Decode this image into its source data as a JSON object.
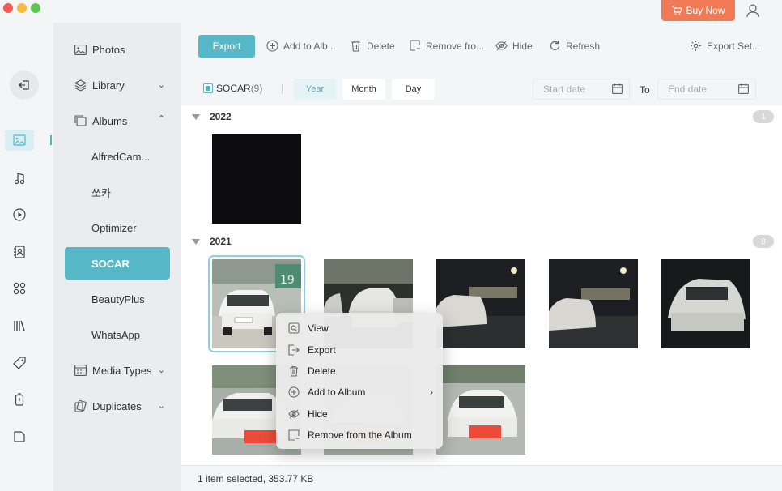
{
  "header": {
    "buy_now": "Buy Now"
  },
  "sidebar": {
    "items": [
      {
        "label": "Photos",
        "icon": "photos-icon"
      },
      {
        "label": "Library",
        "icon": "layers-icon"
      },
      {
        "label": "Albums",
        "icon": "albums-icon"
      },
      {
        "label": "AlfredCam..."
      },
      {
        "label": "쏘카"
      },
      {
        "label": "Optimizer"
      },
      {
        "label": "SOCAR"
      },
      {
        "label": "BeautyPlus"
      },
      {
        "label": "WhatsApp"
      },
      {
        "label": "Media Types",
        "icon": "media-types-icon"
      },
      {
        "label": "Duplicates",
        "icon": "duplicates-icon"
      }
    ]
  },
  "toolbar": {
    "export": "Export",
    "add_to_album": "Add to Alb...",
    "delete": "Delete",
    "remove_from": "Remove fro...",
    "hide": "Hide",
    "refresh": "Refresh",
    "export_settings": "Export Set..."
  },
  "filter": {
    "album_name": "SOCAR",
    "album_count": "(9)",
    "year": "Year",
    "month": "Month",
    "day": "Day",
    "start_placeholder": "Start date",
    "to": "To",
    "end_placeholder": "End date"
  },
  "groups": [
    {
      "year": "2022",
      "count": "1"
    },
    {
      "year": "2021",
      "count": "8"
    }
  ],
  "context_menu": {
    "items": [
      "View",
      "Export",
      "Delete",
      "Add to Album",
      "Hide",
      "Remove from the Album"
    ]
  },
  "status": {
    "text": "1 item selected, 353.77 KB"
  },
  "colors": {
    "accent": "#56b8c6",
    "buy_now": "#ef7a55"
  }
}
